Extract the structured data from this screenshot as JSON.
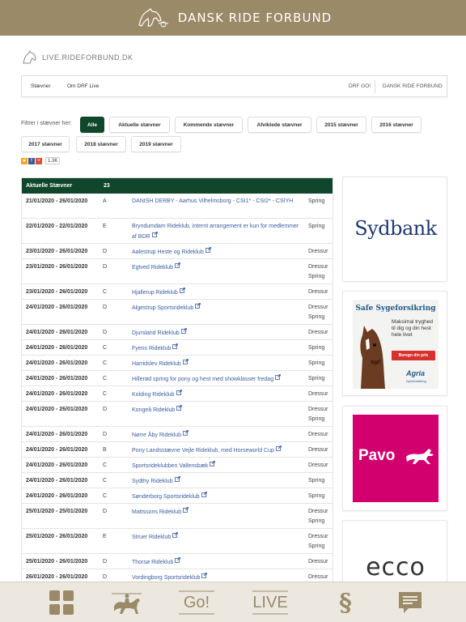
{
  "header": {
    "brand": "DANSK RIDE FORBUND"
  },
  "site": {
    "logo_text": "LIVE.RIDEFORBUND.DK"
  },
  "nav": {
    "left": [
      "Stævner",
      "Om DRF Live"
    ],
    "right": [
      "DRF GO!",
      "DANSK RIDE FORBUND"
    ]
  },
  "filter": {
    "label": "Filtrer i stævner her:",
    "buttons": [
      "Alle",
      "Aktuelle stævner",
      "Kommende stævner",
      "Afviklede stævner",
      "2015 stævner",
      "2016 stævner",
      "2017 stævner",
      "2018 stævner",
      "2019 stævner"
    ],
    "active": "Alle"
  },
  "share": {
    "count": "1.3K"
  },
  "table": {
    "title": "Aktuelle Stævner",
    "count": "23",
    "rows": [
      {
        "date": "21/01/2020 - 26/01/2020",
        "cls": "A",
        "name": "DANISH DERBY - Aarhus Vilhelmsborg - CSI1* - CSI2* - CSIYH",
        "link": false,
        "type": "Spring"
      },
      {
        "date": "22/01/2020 - 22/01/2020",
        "cls": "E",
        "name": "Bryndumdam Rideklub, internt arrangement er kun for medlemmer af BDR",
        "link": true,
        "type": "Spring"
      },
      {
        "date": "23/01/2020 - 26/01/2020",
        "cls": "D",
        "name": "Aalestrup Heste og Rideklub",
        "link": true,
        "type": "Dressur"
      },
      {
        "date": "23/01/2020 - 26/01/2020",
        "cls": "D",
        "name": "Egtved Rideklub",
        "link": true,
        "type": "Dressur\nSpring"
      },
      {
        "date": "23/01/2020 - 26/01/2020",
        "cls": "C",
        "name": "Hjallerup Rideklub",
        "link": true,
        "type": "Dressur"
      },
      {
        "date": "24/01/2020 - 26/01/2020",
        "cls": "D",
        "name": "Algestrup Sportsrideklub",
        "link": true,
        "type": "Dressur\nSpring"
      },
      {
        "date": "24/01/2020 - 26/01/2020",
        "cls": "D",
        "name": "Djursland Rideklub",
        "link": true,
        "type": "Dressur"
      },
      {
        "date": "24/01/2020 - 26/01/2020",
        "cls": "C",
        "name": "Fyens Rideklub",
        "link": true,
        "type": "Spring"
      },
      {
        "date": "24/01/2020 - 26/01/2020",
        "cls": "C",
        "name": "Harridslev Rideklub",
        "link": true,
        "type": "Spring"
      },
      {
        "date": "24/01/2020 - 26/01/2020",
        "cls": "C",
        "name": "Hillerød spring for pony og hest med showklasser fredag",
        "link": true,
        "type": "Spring"
      },
      {
        "date": "24/01/2020 - 26/01/2020",
        "cls": "C",
        "name": "Kolding Rideklub",
        "link": true,
        "type": "Dressur"
      },
      {
        "date": "24/01/2020 - 26/01/2020",
        "cls": "D",
        "name": "Kongeå Rideklub",
        "link": true,
        "type": "Dressur\nSpring"
      },
      {
        "date": "24/01/2020 - 26/01/2020",
        "cls": "D",
        "name": "Nørre Åby Rideklub",
        "link": true,
        "type": "Dressur"
      },
      {
        "date": "24/01/2020 - 26/01/2020",
        "cls": "B",
        "name": "Pony Landsstævne Vejle Rideklub, med Horseworld Cup",
        "link": true,
        "type": "Dressur"
      },
      {
        "date": "24/01/2020 - 26/01/2020",
        "cls": "C",
        "name": "Sportsrideklubben Vallensbæk",
        "link": true,
        "type": "Dressur"
      },
      {
        "date": "24/01/2020 - 26/01/2020",
        "cls": "C",
        "name": "Sydthy Rideklub",
        "link": true,
        "type": "Spring"
      },
      {
        "date": "24/01/2020 - 26/01/2020",
        "cls": "C",
        "name": "Sønderborg Sportsrideklub",
        "link": true,
        "type": "Spring"
      },
      {
        "date": "25/01/2020 - 25/01/2020",
        "cls": "D",
        "name": "Mattssons Rideklub",
        "link": true,
        "type": "Dressur\nSpring"
      },
      {
        "date": "25/01/2020 - 26/01/2020",
        "cls": "E",
        "name": "Struer Rideklub",
        "link": true,
        "type": "Dressur\nSpring"
      },
      {
        "date": "25/01/2020 - 26/01/2020",
        "cls": "D",
        "name": "Thorsø Rideklub",
        "link": true,
        "type": "Dressur"
      },
      {
        "date": "26/01/2020 - 26/01/2020",
        "cls": "D",
        "name": "Vordingborg Sportsrideklub",
        "link": true,
        "type": "Dressur"
      }
    ]
  },
  "ads": {
    "sydbank": "Sydbank",
    "agria": {
      "title": "Safe Sygeforsikring",
      "body": "Maksimal tryghed til dig og din hest hele livet",
      "cta": "Beregn din pris",
      "brand": "Agria",
      "sub": "Dyreforsikring"
    },
    "pavo": "Pavo",
    "ecco": "ecco"
  },
  "tabbar": {
    "go": "Go!",
    "live": "LIVE",
    "paragraph": "§"
  },
  "colors": {
    "gold": "#9b8a68",
    "green": "#10462b",
    "link": "#3b5ea0",
    "pavo": "#d2006e",
    "sydbank": "#1f3a6e"
  }
}
